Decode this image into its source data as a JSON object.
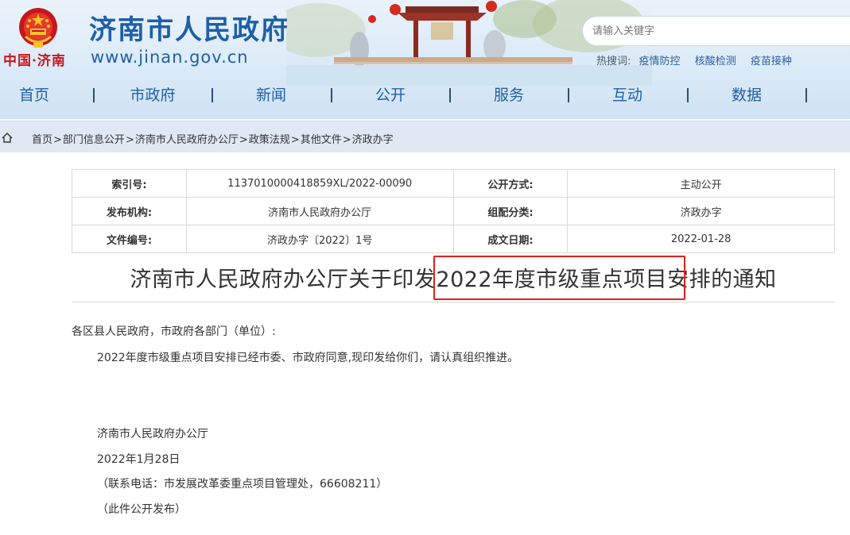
{
  "header": {
    "emblem_text": "中国·济南",
    "site_title": "济南市人民政府",
    "site_url": "www.jinan.gov.cn",
    "search_placeholder": "请输入关键字",
    "hot_label": "热搜词:",
    "hot_words": [
      "疫情防控",
      "核酸检测",
      "疫苗接种"
    ]
  },
  "nav": {
    "items": [
      "首页",
      "市政府",
      "新闻",
      "公开",
      "服务",
      "互动",
      "数据"
    ]
  },
  "breadcrumb": {
    "items": [
      "首页",
      "部门信息公开",
      "济南市人民政府办公厅",
      "政策法规",
      "其他文件",
      "济政办字"
    ],
    "separator": ">"
  },
  "meta": {
    "rows": [
      {
        "k1": "索引号:",
        "v1": "11370100004188​59XL/2022-00090",
        "k2": "公开方式:",
        "v2": "主动公开"
      },
      {
        "k1": "发布机构:",
        "v1": "济南市人民政府办公厅",
        "k2": "组配分类:",
        "v2": "济政办字"
      },
      {
        "k1": "文件编号:",
        "v1": "济政办字〔2022〕1号",
        "k2": "成文日期:",
        "v2": "2022-01-28"
      }
    ]
  },
  "document": {
    "title": "济南市人民政府办公厅关于印发2022年度市级重点项目安排的通知",
    "salutation": "各区县人民政府，市政府各部门（单位）:",
    "body": "2022年度市级重点项目安排已经市委、市政府同意,现印发给你们，请认真组织推进。",
    "signer": "济南市人民政府办公厅",
    "date": "2022年1月28日",
    "contact": "（联系电话：市发展改革委重点项目管理处，66608211）",
    "publicity": "（此件公开发布）"
  },
  "colors": {
    "brand_blue": "#1f5fa6",
    "emblem_red": "#c8161d",
    "highlight_red": "#e02020"
  }
}
